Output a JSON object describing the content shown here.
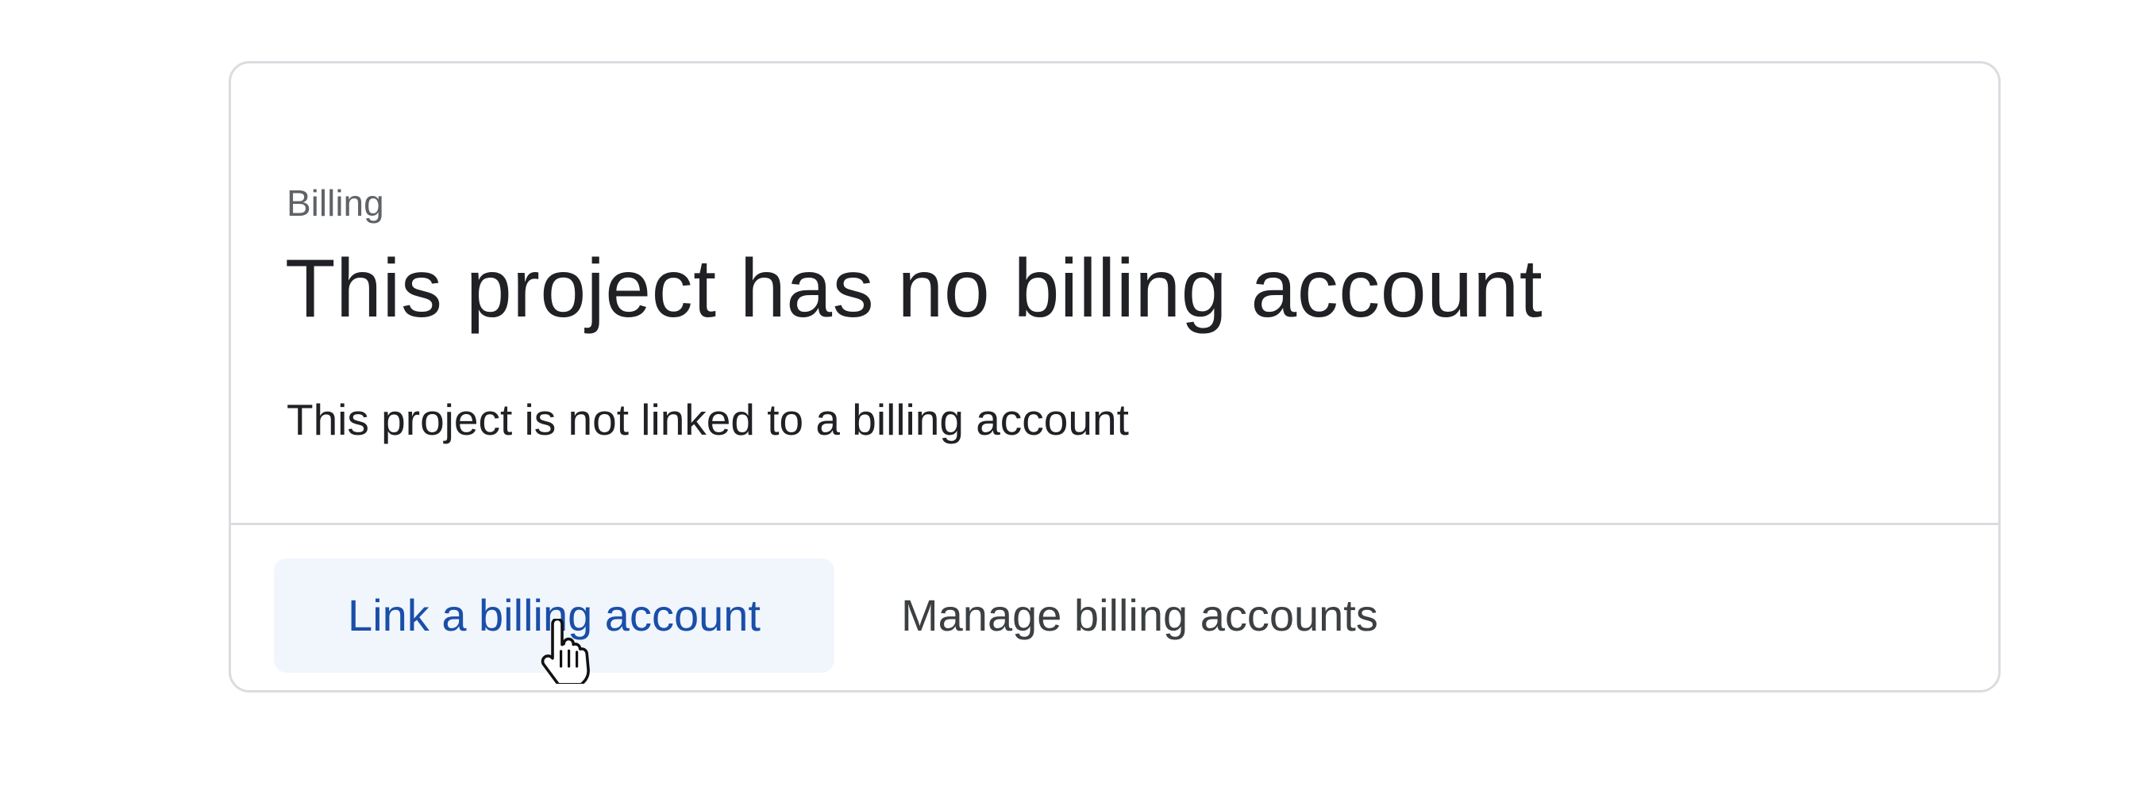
{
  "billing_card": {
    "overline": "Billing",
    "title": "This project has no billing account",
    "description": "This project is not linked to a billing account",
    "actions": {
      "link_label": "Link a billing account",
      "manage_label": "Manage billing accounts"
    }
  },
  "colors": {
    "primary_action_text": "#1a4fa8",
    "primary_action_bg": "#f1f6fd",
    "border": "#dadce0"
  },
  "icons": {
    "cursor": "hand-pointer-icon"
  }
}
